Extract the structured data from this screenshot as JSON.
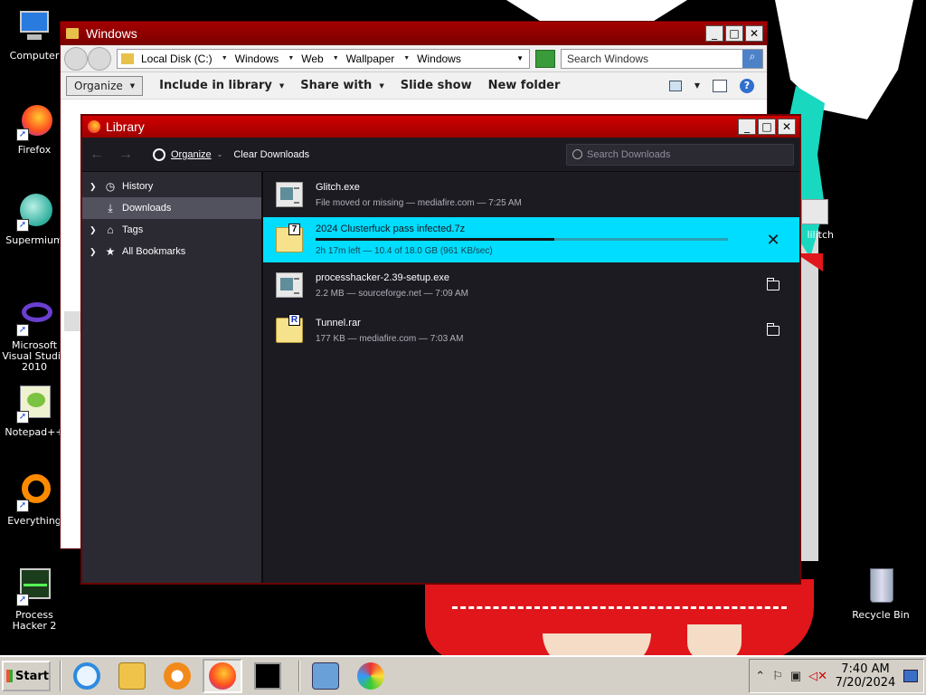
{
  "desktop": {
    "icons": [
      {
        "label": "Computer",
        "icon": "computer-icon"
      },
      {
        "label": "Firefox",
        "icon": "firefox-icon"
      },
      {
        "label": "Supermium",
        "icon": "supermium-icon"
      },
      {
        "label": "Microsoft Visual Studio 2010",
        "icon": "visual-studio-icon"
      },
      {
        "label": "Notepad++",
        "icon": "notepadpp-icon"
      },
      {
        "label": "Everything",
        "icon": "everything-icon"
      },
      {
        "label": "Process Hacker 2",
        "icon": "process-hacker-icon"
      },
      {
        "label": "Recycle Bin",
        "icon": "recycle-bin-icon"
      },
      {
        "label": "lilitch",
        "icon": "glitch-file-icon"
      }
    ]
  },
  "explorer": {
    "title": "Windows",
    "breadcrumbs": [
      "Local Disk (C:)",
      "Windows",
      "Web",
      "Wallpaper",
      "Windows"
    ],
    "search_placeholder": "Search Windows",
    "commands": {
      "organize": "Organize",
      "include": "Include in library",
      "share": "Share with",
      "slideshow": "Slide show",
      "newfolder": "New folder"
    },
    "help": "?"
  },
  "library": {
    "title": "Library",
    "toolbar": {
      "organize": "Organize",
      "clear": "Clear Downloads",
      "search_placeholder": "Search Downloads"
    },
    "sidebar": [
      {
        "label": "History",
        "icon": "clock-icon",
        "expandable": true
      },
      {
        "label": "Downloads",
        "icon": "download-icon",
        "expandable": false
      },
      {
        "label": "Tags",
        "icon": "tag-icon",
        "expandable": true
      },
      {
        "label": "All Bookmarks",
        "icon": "star-icon",
        "expandable": true
      }
    ],
    "downloads": [
      {
        "name": "Glitch.exe",
        "status": "File moved or missing — mediafire.com — 7:25 AM",
        "type": "exe"
      },
      {
        "name": "2024 Clusterfuck pass infected.7z",
        "status": "2h 17m left — 10.4 of 18.0 GB (961 KB/sec)",
        "type": "7z",
        "progress": 0.58
      },
      {
        "name": "processhacker-2.39-setup.exe",
        "status": "2.2 MB — sourceforge.net — 7:09 AM",
        "type": "exe"
      },
      {
        "name": "Tunnel.rar",
        "status": "177 KB — mediafire.com — 7:03 AM",
        "type": "rar"
      }
    ]
  },
  "taskbar": {
    "start": "Start",
    "time": "7:40 AM",
    "date": "7/20/2024"
  },
  "colors": {
    "accent_red": "#a30000",
    "active_download": "#00ddff",
    "library_bg": "#1c1b22"
  }
}
